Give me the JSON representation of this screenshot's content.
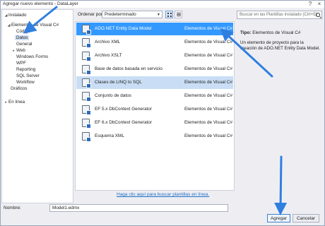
{
  "window": {
    "title": "Agregar nuevo elemento - DataLayer"
  },
  "tree": {
    "installed": "Instalado",
    "items": [
      {
        "label": "Elementos de Visual C#"
      },
      {
        "label": "Código"
      },
      {
        "label": "Datos"
      },
      {
        "label": "General"
      },
      {
        "label": "Web"
      },
      {
        "label": "Windows Forms"
      },
      {
        "label": "WPF"
      },
      {
        "label": "Reporting"
      },
      {
        "label": "SQL Server"
      },
      {
        "label": "Workflow"
      },
      {
        "label": "Gráficos"
      }
    ],
    "online": "En línea"
  },
  "toolbar": {
    "sort_label": "Ordenar por:",
    "sort_value": "Predeterminado"
  },
  "templates": [
    {
      "name": "ADO.NET Entity Data Model",
      "category": "Elementos de Visual C#"
    },
    {
      "name": "Archivo XML",
      "category": "Elementos de Visual C#"
    },
    {
      "name": "Archivo XSLT",
      "category": "Elementos de Visual C#"
    },
    {
      "name": "Base de datos basada en servicio",
      "category": "Elementos de Visual C#"
    },
    {
      "name": "Clases de LINQ to SQL",
      "category": "Elementos de Visual C#"
    },
    {
      "name": "Conjunto de datos",
      "category": "Elementos de Visual C#"
    },
    {
      "name": "EF 5.x DbContext Generator",
      "category": "Elementos de Visual C#"
    },
    {
      "name": "EF 6.x DbContext Generator",
      "category": "Elementos de Visual C#"
    },
    {
      "name": "Esquema XML",
      "category": "Elementos de Visual C#"
    }
  ],
  "online_link": "Haga clic aquí para buscar plantillas en línea.",
  "details": {
    "search_placeholder": "Buscar en las Plantillas instalado (Ctrl+E)",
    "type_label": "Tipo:",
    "type_value": "Elementos de Visual C#",
    "description": "Un elemento de proyecto para la creación de ADO.NET Entity Data Model."
  },
  "name_field": {
    "label": "Nombre:",
    "value": "Model1.edmx"
  },
  "buttons": {
    "add": "Agregar",
    "cancel": "Cancelar"
  },
  "colors": {
    "selection": "#3399ff",
    "highlight": "#c9def5",
    "arrow": "#2f7fe0"
  }
}
